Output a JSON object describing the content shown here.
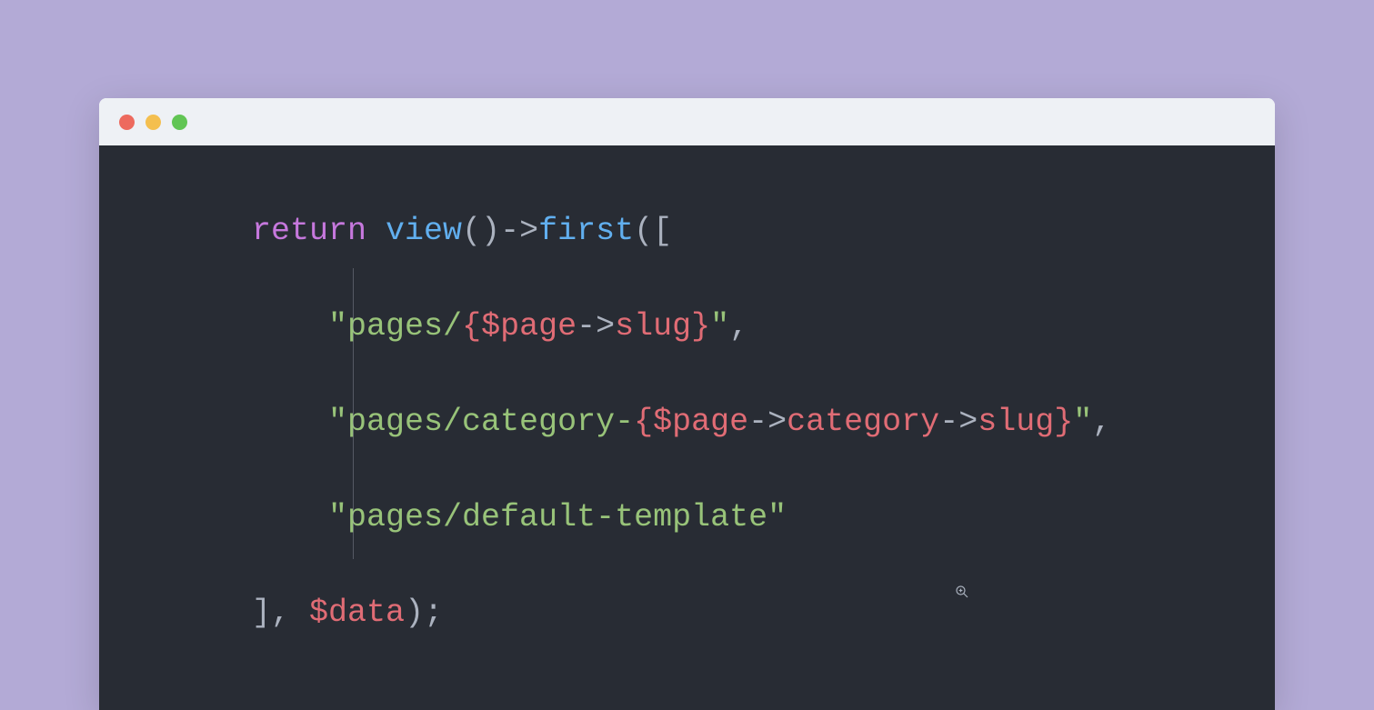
{
  "colors": {
    "background": "#b3aad6",
    "editor_bg": "#282c34",
    "titlebar_bg": "#eef1f5",
    "traffic_red": "#ed6a5e",
    "traffic_yellow": "#f4bf4f",
    "traffic_green": "#61c554",
    "keyword": "#c678dd",
    "function": "#61afef",
    "punctuation": "#abb2bf",
    "string": "#98c379",
    "interpolation": "#e06c75",
    "variable": "#e06c75"
  },
  "code": {
    "line1": {
      "return": "return",
      "space1": " ",
      "view": "view",
      "parens": "()",
      "arrow": "->",
      "first": "first",
      "open": "(["
    },
    "line2": {
      "indent": "    ",
      "q1": "\"",
      "str1": "pages/",
      "interp_open": "{",
      "var": "$page",
      "arrow": "->",
      "prop": "slug",
      "interp_close": "}",
      "q2": "\"",
      "comma": ","
    },
    "line3": {
      "indent": "    ",
      "q1": "\"",
      "str1": "pages/category-",
      "interp_open": "{",
      "var": "$page",
      "arrow1": "->",
      "prop1": "category",
      "arrow2": "->",
      "prop2": "slug",
      "interp_close": "}",
      "q2": "\"",
      "comma": ","
    },
    "line4": {
      "indent": "    ",
      "q1": "\"",
      "str1": "pages/default-template",
      "q2": "\""
    },
    "line5": {
      "close_bracket": "]",
      "comma_space": ", ",
      "var": "$data",
      "close": ");"
    }
  }
}
